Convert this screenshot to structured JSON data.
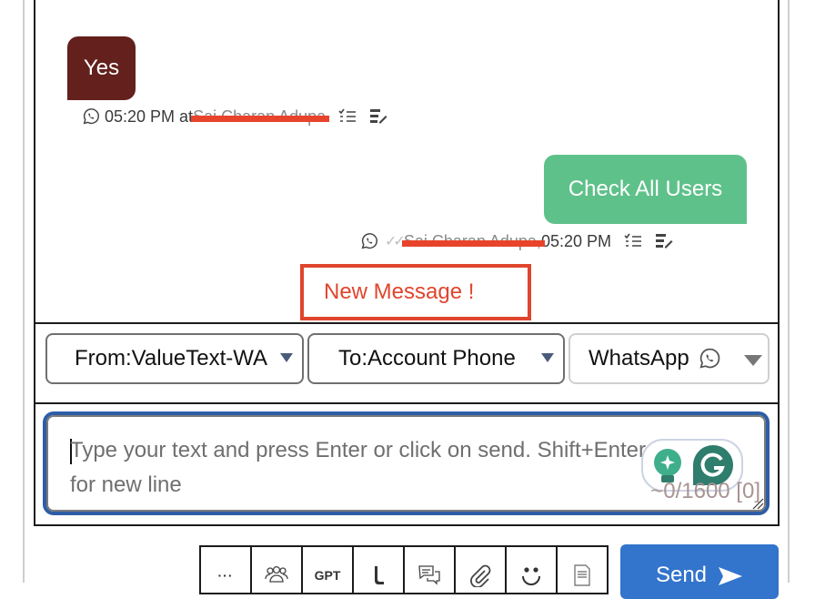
{
  "messages": [
    {
      "direction": "incoming",
      "text": "Yes",
      "time": "05:20 PM",
      "time_prefix_text": "05:20 PM at",
      "sender_redacted": "Sai Charan Adupa",
      "channel_icon": "whatsapp-icon",
      "bubble_color": "#63201d"
    },
    {
      "direction": "outgoing",
      "text": "Check All Users",
      "sender_redacted": "Sai Charan Adupa,",
      "time": "05:20 PM",
      "status": "delivered-double-check",
      "channel_icon": "whatsapp-icon",
      "bubble_color": "#5fc18a"
    }
  ],
  "new_message_banner": "New Message !",
  "selectors": {
    "from": "From:ValueText-WA",
    "to": "To:Account Phone",
    "channel": "WhatsApp"
  },
  "composer": {
    "placeholder": "Type your text and press Enter or click on send. Shift+Enter for new line",
    "placeholder_line1": "Type your text and press Enter or click on send. Shift+Enter",
    "placeholder_line2": "for new line",
    "counter": "~0/1600 [0]"
  },
  "toolbar": {
    "buttons": [
      {
        "name": "more",
        "label": "···"
      },
      {
        "name": "group",
        "label": ""
      },
      {
        "name": "gpt",
        "label": "GPT"
      },
      {
        "name": "call",
        "label": ""
      },
      {
        "name": "templates",
        "label": ""
      },
      {
        "name": "attach",
        "label": ""
      },
      {
        "name": "emoji",
        "label": ""
      },
      {
        "name": "document",
        "label": ""
      }
    ],
    "send_label": "Send"
  },
  "colors": {
    "accent": "#3374cc",
    "alert": "#e0452d",
    "composer_focus": "#2d5da6"
  }
}
